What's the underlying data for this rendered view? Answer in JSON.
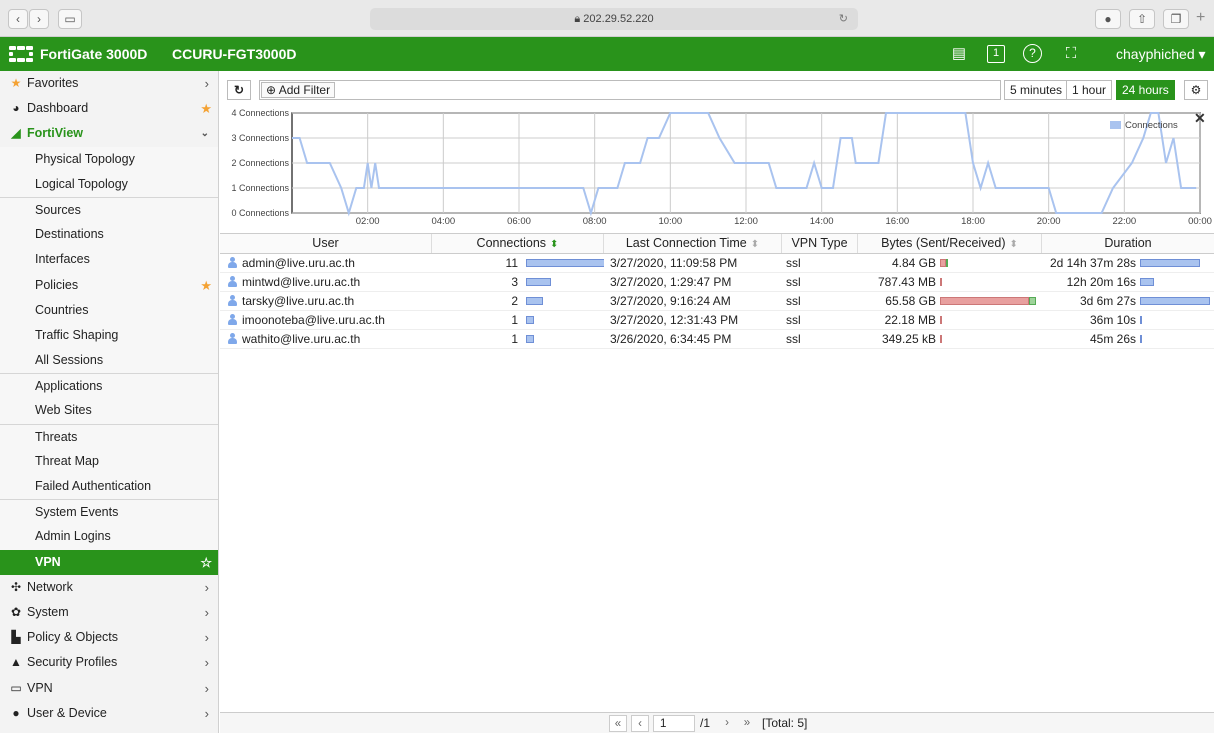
{
  "browser": {
    "url": "202.29.52.220"
  },
  "header": {
    "brand": "FortiGate 3000D",
    "hostname": "CCURU-FGT3000D",
    "user": "chayphiched"
  },
  "sidebar": {
    "favorites": "Favorites",
    "dashboard": "Dashboard",
    "fortiview": "FortiView",
    "items": [
      "Physical Topology",
      "Logical Topology",
      "Sources",
      "Destinations",
      "Interfaces",
      "Policies",
      "Countries",
      "Traffic Shaping",
      "All Sessions",
      "Applications",
      "Web Sites",
      "Threats",
      "Threat Map",
      "Failed Authentication",
      "System Events",
      "Admin Logins",
      "VPN"
    ],
    "sections": [
      "Network",
      "System",
      "Policy & Objects",
      "Security Profiles",
      "VPN",
      "User & Device"
    ]
  },
  "toolbar": {
    "add_filter": "Add Filter",
    "time_options": [
      "5 minutes",
      "1 hour",
      "24 hours"
    ],
    "selected_time": "24 hours"
  },
  "chart_data": {
    "type": "line",
    "series": [
      {
        "name": "Connections",
        "color": "#a9c3ef"
      }
    ],
    "y_ticks": [
      "0 Connections",
      "1 Connections",
      "2 Connections",
      "3 Connections",
      "4 Connections"
    ],
    "x_ticks": [
      "02:00",
      "04:00",
      "06:00",
      "08:00",
      "10:00",
      "12:00",
      "14:00",
      "16:00",
      "18:00",
      "20:00",
      "22:00",
      "00:00"
    ],
    "ylim": [
      0,
      4
    ],
    "legend": "top-right",
    "points": [
      [
        0,
        3
      ],
      [
        0.2,
        3
      ],
      [
        0.4,
        2
      ],
      [
        1.0,
        2
      ],
      [
        1.3,
        1
      ],
      [
        1.5,
        0
      ],
      [
        1.7,
        1
      ],
      [
        1.9,
        1
      ],
      [
        2.0,
        2
      ],
      [
        2.1,
        1
      ],
      [
        2.2,
        2
      ],
      [
        2.3,
        1
      ],
      [
        3,
        1
      ],
      [
        4,
        1
      ],
      [
        5,
        1
      ],
      [
        6,
        1
      ],
      [
        7,
        1
      ],
      [
        7.7,
        1
      ],
      [
        7.9,
        0
      ],
      [
        8.1,
        1
      ],
      [
        8.6,
        1
      ],
      [
        8.8,
        2
      ],
      [
        9.2,
        2
      ],
      [
        9.4,
        3
      ],
      [
        9.7,
        3
      ],
      [
        10.0,
        4
      ],
      [
        10.2,
        4
      ],
      [
        11.0,
        4
      ],
      [
        11.3,
        3
      ],
      [
        11.7,
        2
      ],
      [
        12.6,
        2
      ],
      [
        12.8,
        1
      ],
      [
        13.6,
        1
      ],
      [
        13.8,
        2
      ],
      [
        14.0,
        1
      ],
      [
        14.3,
        1
      ],
      [
        14.5,
        3
      ],
      [
        14.8,
        3
      ],
      [
        14.9,
        2
      ],
      [
        15.5,
        2
      ],
      [
        15.7,
        4
      ],
      [
        17.8,
        4
      ],
      [
        18.0,
        2
      ],
      [
        18.2,
        1
      ],
      [
        18.4,
        2
      ],
      [
        18.6,
        1
      ],
      [
        19.4,
        1
      ],
      [
        20.0,
        1
      ],
      [
        20.2,
        0
      ],
      [
        21.4,
        0
      ],
      [
        21.7,
        1
      ],
      [
        22.2,
        2
      ],
      [
        22.5,
        3
      ],
      [
        22.7,
        4
      ],
      [
        22.9,
        4
      ],
      [
        23.1,
        2
      ],
      [
        23.3,
        3
      ],
      [
        23.5,
        1
      ],
      [
        23.9,
        1
      ]
    ]
  },
  "table": {
    "columns": [
      "User",
      "Connections",
      "Last Connection Time",
      "VPN Type",
      "Bytes (Sent/Received)",
      "Duration"
    ],
    "rows": [
      {
        "user": "admin@live.uru.ac.th",
        "connections": "11",
        "conn_frac": 1.0,
        "time": "3/27/2020, 11:09:58 PM",
        "vpn": "ssl",
        "bytes": "4.84 GB",
        "bytes_frac": 0.07,
        "duration": "2d 14h 37m 28s",
        "dur_frac": 0.85
      },
      {
        "user": "mintwd@live.uru.ac.th",
        "connections": "3",
        "conn_frac": 0.27,
        "time": "3/27/2020, 1:29:47 PM",
        "vpn": "ssl",
        "bytes": "787.43 MB",
        "bytes_frac": 0.01,
        "duration": "12h 20m 16s",
        "dur_frac": 0.2
      },
      {
        "user": "tarsky@live.uru.ac.th",
        "connections": "2",
        "conn_frac": 0.18,
        "time": "3/27/2020, 9:16:24 AM",
        "vpn": "ssl",
        "bytes": "65.58 GB",
        "bytes_frac": 1.0,
        "duration": "3d 6m 27s",
        "dur_frac": 1.0
      },
      {
        "user": "imoonoteba@live.uru.ac.th",
        "connections": "1",
        "conn_frac": 0.09,
        "time": "3/27/2020, 12:31:43 PM",
        "vpn": "ssl",
        "bytes": "22.18 MB",
        "bytes_frac": 0.005,
        "duration": "36m 10s",
        "dur_frac": 0.01
      },
      {
        "user": "wathito@live.uru.ac.th",
        "connections": "1",
        "conn_frac": 0.09,
        "time": "3/26/2020, 6:34:45 PM",
        "vpn": "ssl",
        "bytes": "349.25 kB",
        "bytes_frac": 0.003,
        "duration": "45m 26s",
        "dur_frac": 0.01
      }
    ]
  },
  "pager": {
    "page": "1",
    "total_pages": "/1",
    "total": "[Total: 5]"
  }
}
